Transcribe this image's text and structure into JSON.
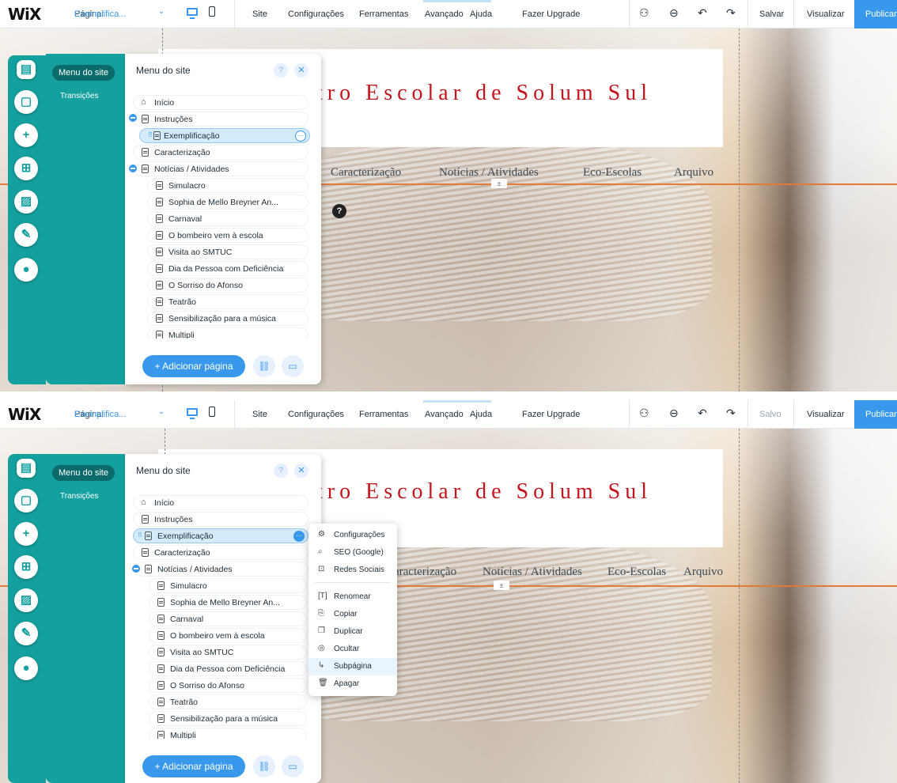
{
  "topbar": {
    "logo": "WiX",
    "page_label": "Página:",
    "page_value": "Exemplifica...",
    "chevron": "⌄",
    "menu": [
      "Site",
      "Configurações",
      "Ferramentas",
      "Avançado",
      "Ajuda",
      "Fazer Upgrade"
    ],
    "icons": [
      "collaborators-icon",
      "zoom-icon",
      "undo-icon",
      "redo-icon"
    ],
    "save_first": "Salvar",
    "save_second": "Salvo",
    "preview": "Visualizar",
    "publish": "Publicar"
  },
  "leftbar": {
    "icons": [
      "pages-icon",
      "background-icon",
      "add-icon",
      "app-market-icon",
      "media-icon",
      "blog-icon",
      "chat-icon"
    ]
  },
  "panel": {
    "tab_site": "Menu do site",
    "tab_transitions": "Transições",
    "title": "Menu do site",
    "help": "?",
    "close": "✕",
    "add_page": "+ Adicionar página",
    "pages": [
      "Início",
      "Instruções",
      "Exemplificação",
      "Caracterização",
      "Notícias / Atividades",
      "Simulacro",
      "Sophia de Mello Breyner An...",
      "Carnaval",
      "O bombeiro vem à escola",
      "Visita ao SMTUC",
      "Dia da Pessoa com Deficiência",
      "O Sorriso do Afonso",
      "Teatrão",
      "Sensibilização para a música",
      "Multipli"
    ]
  },
  "site": {
    "title": "tro Escolar de Solum Sul",
    "nav_first": [
      "Caracterização",
      "Notícias / Atividades",
      "Eco-Escolas",
      "Arquivo"
    ],
    "nav_second": [
      "aracterização",
      "Notícias / Atividades",
      "Eco-Escolas",
      "Arquivo"
    ],
    "help_badge": "?"
  },
  "context_menu": {
    "items": [
      "Configurações",
      "SEO (Google)",
      "Redes Sociais",
      "Renomear",
      "Copiar",
      "Duplicar",
      "Ocultar",
      "Subpágina",
      "Apagar"
    ],
    "hovered": "Subpágina"
  },
  "colors": {
    "accent": "#3899ec",
    "teal": "#14a09e",
    "title_red": "#c4141c",
    "nav_line": "#e07b39"
  }
}
